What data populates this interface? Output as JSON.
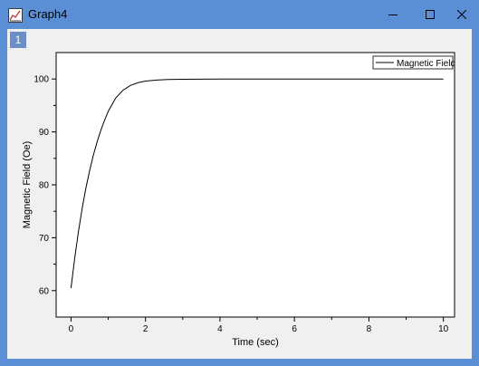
{
  "window": {
    "title": "Graph4",
    "minimize_glyph": "—",
    "maximize_glyph": "☐",
    "close_glyph": "✕",
    "icon": "graph-window-icon"
  },
  "layer": {
    "tab_label": "1"
  },
  "chart_data": {
    "type": "line",
    "xlabel": "Time (sec)",
    "ylabel": "Magnetic Field (Oe)",
    "xlim": [
      -0.4,
      10.3
    ],
    "ylim": [
      55,
      105
    ],
    "xticks": [
      0,
      2,
      4,
      6,
      8,
      10
    ],
    "yticks": [
      60,
      70,
      80,
      90,
      100
    ],
    "grid": false,
    "legend_position": "top-right",
    "series": [
      {
        "name": "Magnetic Field",
        "color": "#000000",
        "x": [
          0,
          0.1,
          0.2,
          0.3,
          0.4,
          0.5,
          0.6,
          0.7,
          0.8,
          0.9,
          1.0,
          1.2,
          1.4,
          1.6,
          1.8,
          2.0,
          2.3,
          2.6,
          3.0,
          3.5,
          4.0,
          5.0,
          6.0,
          7.0,
          8.0,
          9.0,
          10.0
        ],
        "y": [
          60.5,
          66.2,
          71.2,
          75.6,
          79.4,
          82.7,
          85.6,
          88.1,
          90.3,
          92.2,
          93.9,
          96.4,
          97.9,
          98.8,
          99.3,
          99.6,
          99.8,
          99.9,
          99.95,
          99.98,
          99.99,
          100,
          100,
          100,
          100,
          100,
          100
        ]
      }
    ]
  }
}
